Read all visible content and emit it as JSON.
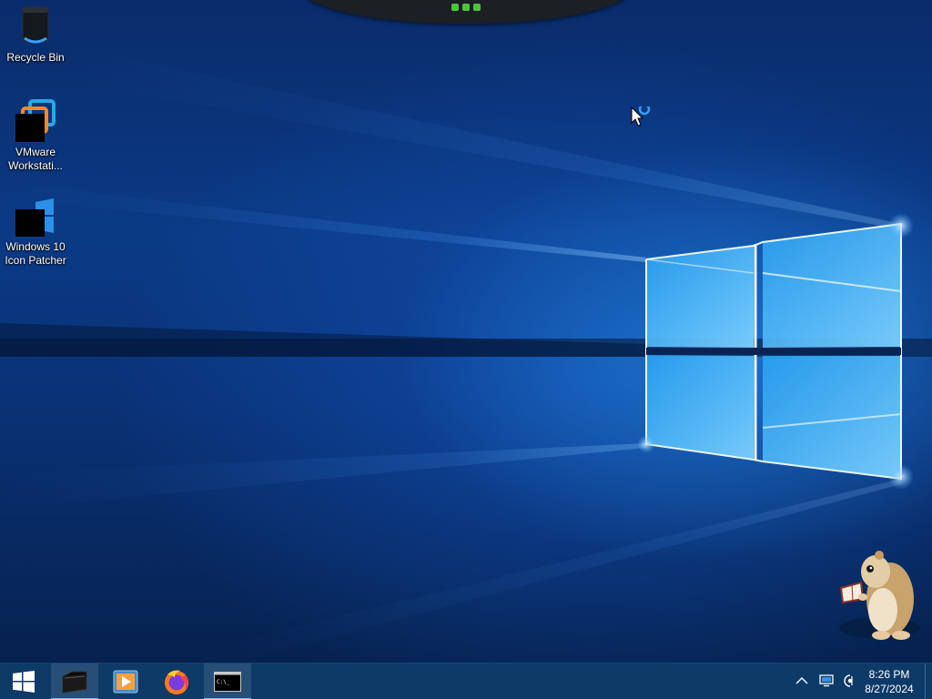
{
  "desktop": {
    "icons": [
      {
        "name": "Recycle Bin",
        "line1": "Recycle Bin",
        "line2": ""
      },
      {
        "name": "VMware Workstation",
        "line1": "VMware",
        "line2": "Workstati..."
      },
      {
        "name": "Windows 10 Icon Patcher",
        "line1": "Windows 10",
        "line2": "Icon Patcher"
      }
    ]
  },
  "taskbar": {
    "start": {
      "icon": "windows-logo-icon"
    },
    "pinned": [
      {
        "name": "file-explorer",
        "icon": "dark-folder-icon",
        "active": true
      },
      {
        "name": "media-player",
        "icon": "media-player-icon",
        "active": false
      },
      {
        "name": "firefox",
        "icon": "firefox-icon",
        "active": false
      },
      {
        "name": "command-prompt",
        "icon": "command-prompt-icon",
        "active": true,
        "glyph": "C:\\_"
      }
    ],
    "tray": {
      "overflow_icon": "chevron-up-icon",
      "network_icon": "network-icon",
      "volume_icon": "volume-icon"
    },
    "clock": {
      "time": "8:26 PM",
      "date": "8/27/2024"
    }
  },
  "colors": {
    "taskbar": "#0e3a68",
    "accent": "#7fb4ea",
    "wallpaper_dark": "#06214e",
    "wallpaper_light": "#2a96f0"
  }
}
